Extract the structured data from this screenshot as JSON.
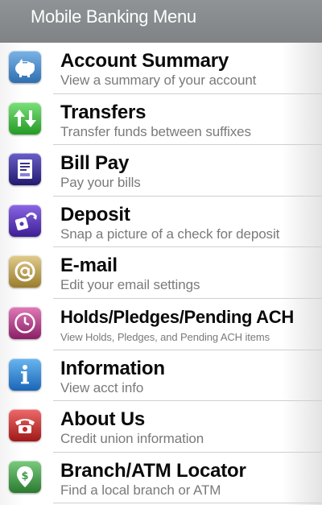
{
  "header": {
    "title": "Mobile Banking Menu"
  },
  "menu": {
    "items": [
      {
        "title": "Account Summary",
        "subtitle": "View a summary of your account",
        "icon": "piggy-bank-icon",
        "color": "#3f86c6"
      },
      {
        "title": "Transfers",
        "subtitle": "Transfer funds between suffixes",
        "icon": "transfer-arrows-icon",
        "color": "#3ab23a"
      },
      {
        "title": "Bill Pay",
        "subtitle": "Pay your bills",
        "icon": "bill-icon",
        "color": "#3a2f8c"
      },
      {
        "title": "Deposit",
        "subtitle": "Snap a picture of a check for deposit",
        "icon": "deposit-icon",
        "color": "#5a34b8"
      },
      {
        "title": "E-mail",
        "subtitle": "Edit your email settings",
        "icon": "at-sign-icon",
        "color": "#b59a4a"
      },
      {
        "title": "Holds/Pledges/Pending ACH",
        "subtitle": "View Holds, Pledges, and Pending ACH items",
        "icon": "clock-icon",
        "color": "#b23a8a"
      },
      {
        "title": "Information",
        "subtitle": "View acct info",
        "icon": "info-icon",
        "color": "#2f86d6"
      },
      {
        "title": "About Us",
        "subtitle": "Credit union information",
        "icon": "telephone-icon",
        "color": "#c42a2a"
      },
      {
        "title": "Branch/ATM Locator",
        "subtitle": "Find a local branch or ATM",
        "icon": "location-dollar-icon",
        "color": "#3f9a46"
      }
    ]
  }
}
